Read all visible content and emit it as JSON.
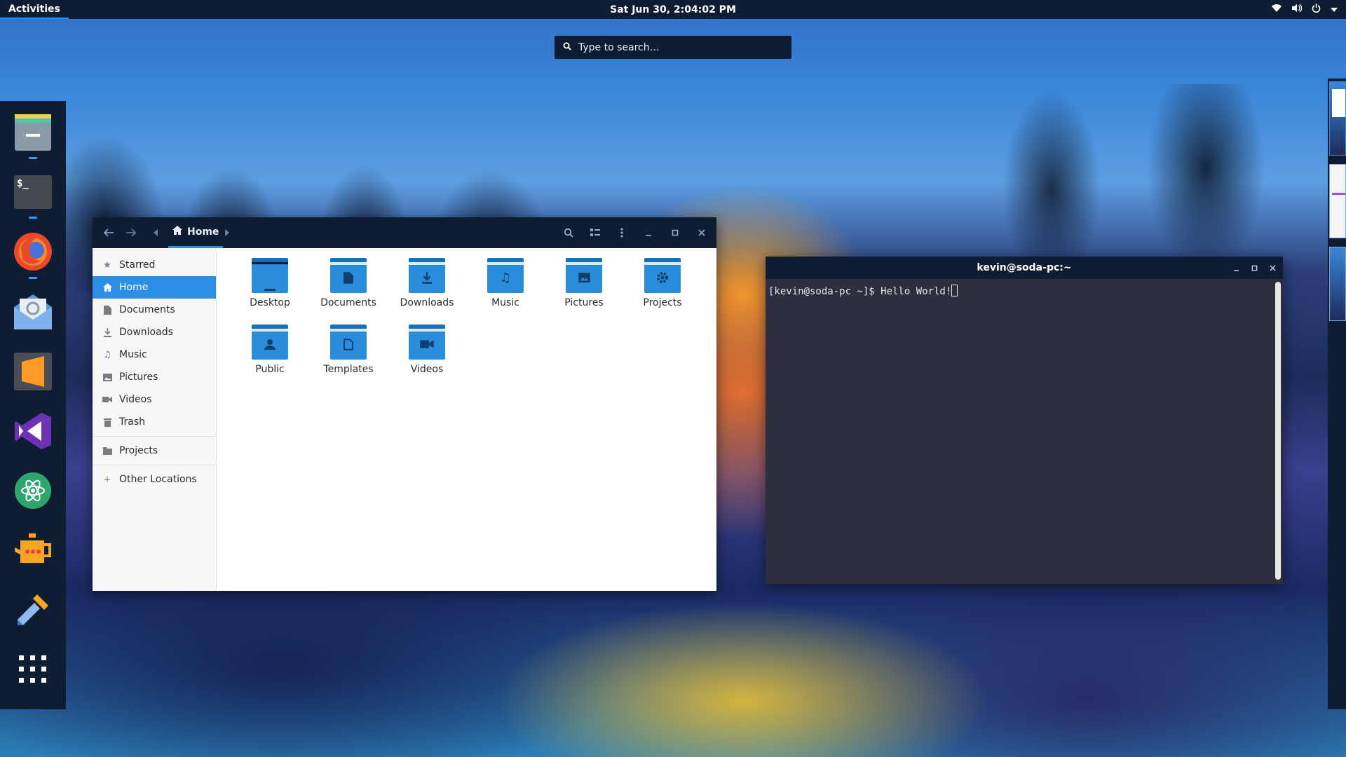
{
  "topbar": {
    "activities": "Activities",
    "clock": "Sat Jun 30,  2:04:02 PM"
  },
  "search": {
    "placeholder": "Type to search…"
  },
  "dash": {
    "apps": [
      "files",
      "terminal",
      "firefox",
      "mail",
      "sublime-text",
      "visual-studio",
      "atom",
      "teapot",
      "color-picker",
      "app-grid"
    ]
  },
  "file_manager": {
    "breadcrumb": "Home",
    "sidebar": {
      "items": [
        {
          "label": "Starred",
          "icon": "star-icon"
        },
        {
          "label": "Home",
          "icon": "home-icon",
          "active": true
        },
        {
          "label": "Documents",
          "icon": "document-icon"
        },
        {
          "label": "Downloads",
          "icon": "download-icon"
        },
        {
          "label": "Music",
          "icon": "music-icon"
        },
        {
          "label": "Pictures",
          "icon": "picture-icon"
        },
        {
          "label": "Videos",
          "icon": "video-icon"
        },
        {
          "label": "Trash",
          "icon": "trash-icon"
        }
      ],
      "bookmarks": [
        {
          "label": "Projects",
          "icon": "folder-icon"
        }
      ],
      "other": {
        "label": "Other Locations",
        "icon": "plus-icon"
      }
    },
    "folders": [
      {
        "label": "Desktop",
        "icon": "desktop"
      },
      {
        "label": "Documents",
        "icon": "document"
      },
      {
        "label": "Downloads",
        "icon": "download"
      },
      {
        "label": "Music",
        "icon": "music"
      },
      {
        "label": "Pictures",
        "icon": "picture"
      },
      {
        "label": "Projects",
        "icon": "gear"
      },
      {
        "label": "Public",
        "icon": "person"
      },
      {
        "label": "Templates",
        "icon": "template"
      },
      {
        "label": "Videos",
        "icon": "video"
      }
    ]
  },
  "terminal": {
    "title": "kevin@soda-pc:~",
    "line": "[kevin@soda-pc ~]$ Hello World!"
  },
  "colors": {
    "panel": "#0f1d33",
    "accent": "#2d8ee6",
    "terminal_bg": "#2e2f3e",
    "folder": "#2a8ddb"
  }
}
